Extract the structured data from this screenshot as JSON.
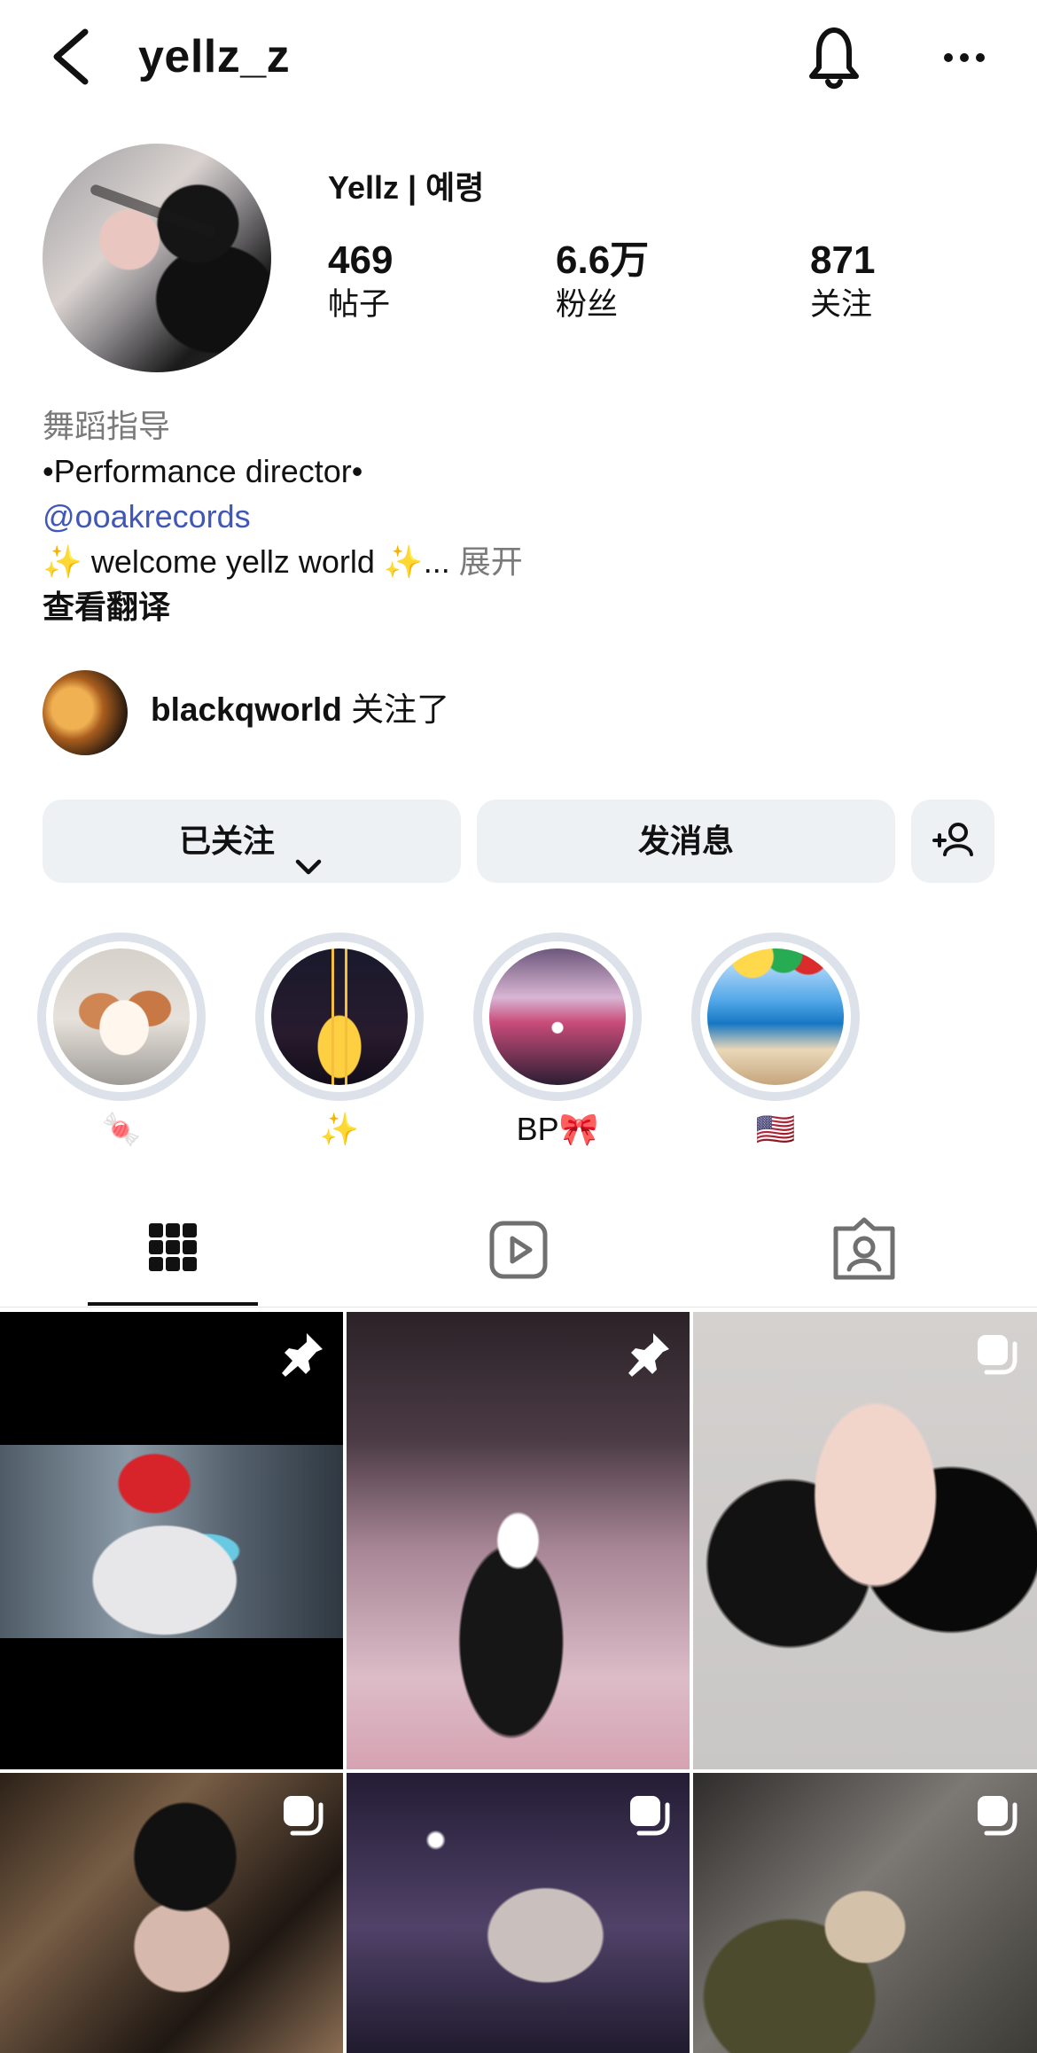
{
  "header": {
    "username": "yellz_z"
  },
  "profile": {
    "display_name": "Yellz | 예령",
    "stats": [
      {
        "value": "469",
        "label": "帖子"
      },
      {
        "value": "6.6万",
        "label": "粉丝"
      },
      {
        "value": "871",
        "label": "关注"
      }
    ]
  },
  "bio": {
    "category": "舞蹈指导",
    "description": "•Performance director•",
    "mention": "@ooakrecords",
    "welcome": "✨ welcome yellz world ✨...",
    "more": "展开",
    "translate": "查看翻译"
  },
  "followed_by": {
    "name": "blackqworld",
    "suffix": "关注了"
  },
  "actions": {
    "following": "已关注",
    "message": "发消息"
  },
  "highlights": [
    {
      "label": "🍬"
    },
    {
      "label": "✨"
    },
    {
      "label": "BP🎀"
    },
    {
      "label": "🇺🇸"
    }
  ],
  "tabs": [
    {
      "name": "posts",
      "icon": "grid-icon",
      "selected": true
    },
    {
      "name": "reels",
      "icon": "reels-icon",
      "selected": false
    },
    {
      "name": "tagged",
      "icon": "tagged-user-icon",
      "selected": false
    }
  ],
  "posts": [
    {
      "icon": "pin-icon"
    },
    {
      "icon": "pin-icon"
    },
    {
      "icon": "carousel-icon"
    },
    {
      "icon": "carousel-icon"
    },
    {
      "icon": "carousel-icon"
    },
    {
      "icon": "carousel-icon"
    }
  ]
}
